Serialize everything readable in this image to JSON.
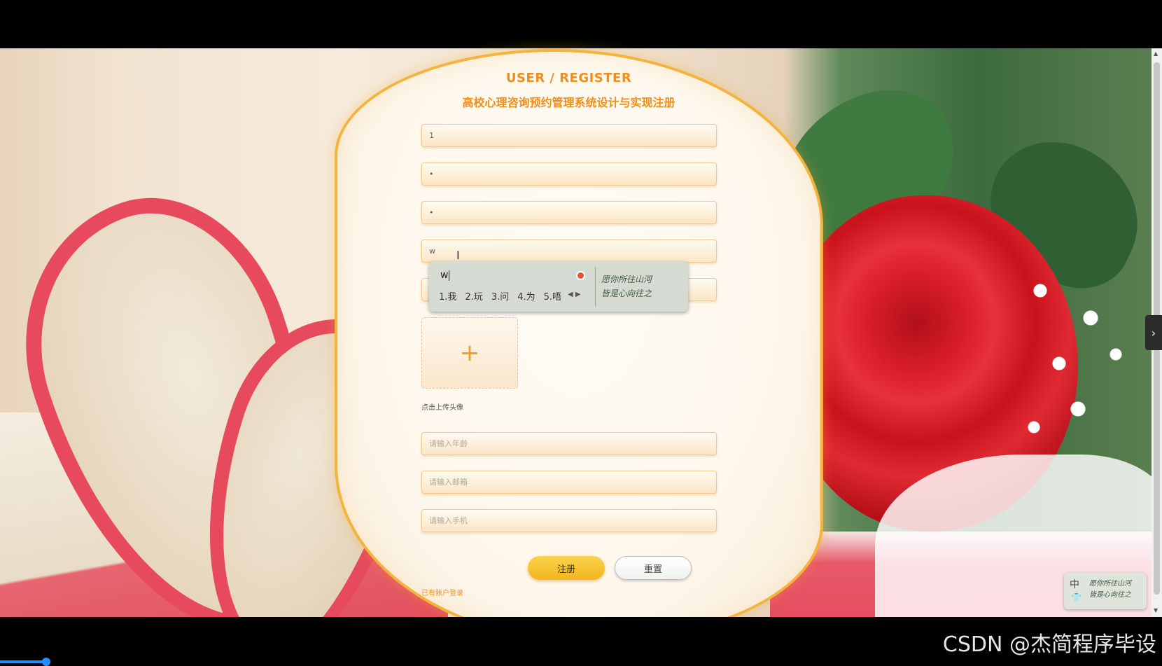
{
  "form": {
    "title": "USER / REGISTER",
    "subtitle": "高校心理咨询预约管理系统设计与实现注册",
    "fields": [
      {
        "value": "1",
        "placeholder": ""
      },
      {
        "value": "•",
        "placeholder": ""
      },
      {
        "value": "•",
        "placeholder": ""
      },
      {
        "value": "w",
        "placeholder": ""
      },
      {
        "value": "",
        "placeholder": ""
      },
      {
        "value": "",
        "placeholder": "请输入年龄"
      },
      {
        "value": "",
        "placeholder": "请输入邮箱"
      },
      {
        "value": "",
        "placeholder": "请输入手机"
      }
    ],
    "upload": {
      "icon": "+",
      "label": "点击上传头像"
    },
    "register_label": "注册",
    "reset_label": "重置",
    "login_link": "已有账户登录"
  },
  "ime": {
    "input": "w",
    "candidates": [
      "1.我",
      "2.玩",
      "3.问",
      "4.为",
      "5.唔"
    ],
    "art_line1": "愿你所往山河",
    "art_line2": "皆是心向往之",
    "mini_mode": "中"
  },
  "watermark": "CSDN @杰简程序毕设"
}
